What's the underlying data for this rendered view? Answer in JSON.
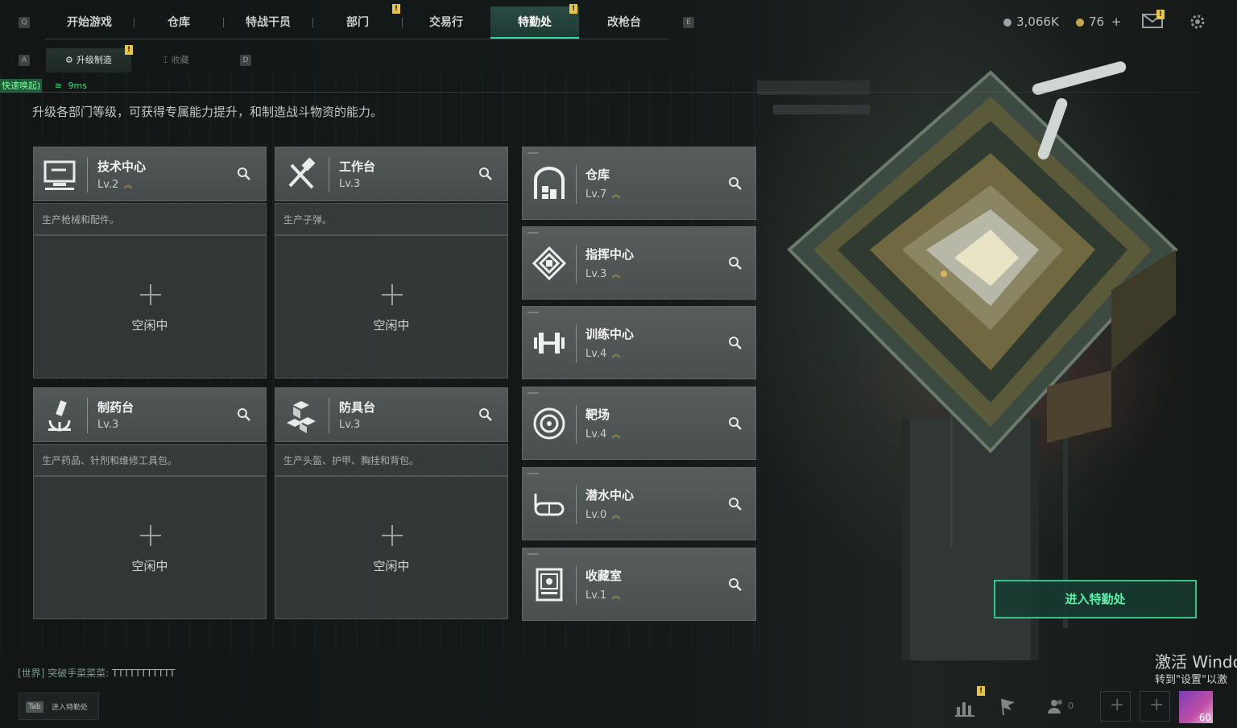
{
  "nav": {
    "key_left": "Q",
    "key_right": "E",
    "tabs": [
      {
        "label": "开始游戏",
        "active": false
      },
      {
        "label": "仓库",
        "active": false
      },
      {
        "label": "特战干员",
        "active": false
      },
      {
        "label": "部门",
        "active": false,
        "badge": "!"
      },
      {
        "label": "交易行",
        "active": false
      },
      {
        "label": "特勤处",
        "active": true,
        "badge": "!"
      },
      {
        "label": "改枪台",
        "active": false
      }
    ],
    "currency_silver": "3,066K",
    "currency_gold": "76",
    "currency_add": "+",
    "mail_badge": "!"
  },
  "subnav": {
    "key_left": "A",
    "key_right": "D",
    "tabs": [
      {
        "label": "升级制造",
        "active": true,
        "badge": "!"
      },
      {
        "label": "收藏",
        "active": false
      }
    ]
  },
  "status": {
    "hint_label": "快速唤起)",
    "ping": "9ms"
  },
  "description": "升级各部门等级，可获得专属能力提升，和制造战斗物资的能力。",
  "workshops": [
    {
      "name": "技术中心",
      "level": "Lv.2",
      "icon": "monitor-icon",
      "desc": "生产枪械和配件。",
      "status": "空闲中"
    },
    {
      "name": "工作台",
      "level": "Lv.3",
      "icon": "tools-icon",
      "desc": "生产子弹。",
      "status": "空闲中"
    },
    {
      "name": "制药台",
      "level": "Lv.3",
      "icon": "microscope-icon",
      "desc": "生产药品、针剂和维修工具包。",
      "status": "空闲中"
    },
    {
      "name": "防具台",
      "level": "Lv.3",
      "icon": "blocks-icon",
      "desc": "生产头盔、护甲、胸挂和背包。",
      "status": "空闲中"
    }
  ],
  "departments": [
    {
      "name": "仓库",
      "level": "Lv.7",
      "icon": "warehouse-icon"
    },
    {
      "name": "指挥中心",
      "level": "Lv.3",
      "icon": "chip-icon"
    },
    {
      "name": "训练中心",
      "level": "Lv.4",
      "icon": "dumbbell-icon"
    },
    {
      "name": "靶场",
      "level": "Lv.4",
      "icon": "target-icon"
    },
    {
      "name": "潜水中心",
      "level": "Lv.0",
      "icon": "goggles-icon"
    },
    {
      "name": "收藏室",
      "level": "Lv.1",
      "icon": "cabinet-icon"
    }
  ],
  "enter_button": "进入特勤处",
  "chat": {
    "channel": "[世界]",
    "user": "突破手菜菜菜:",
    "message": "TTTTTTTTTTT"
  },
  "tab_hint": {
    "key": "Tab",
    "label": "进入特勤处"
  },
  "bottom": {
    "friends_count": "0",
    "player_level": "60",
    "stats_badge": "!"
  },
  "watermark": {
    "line1": "激活 Windo",
    "line2": "转到\"设置\"以激"
  }
}
